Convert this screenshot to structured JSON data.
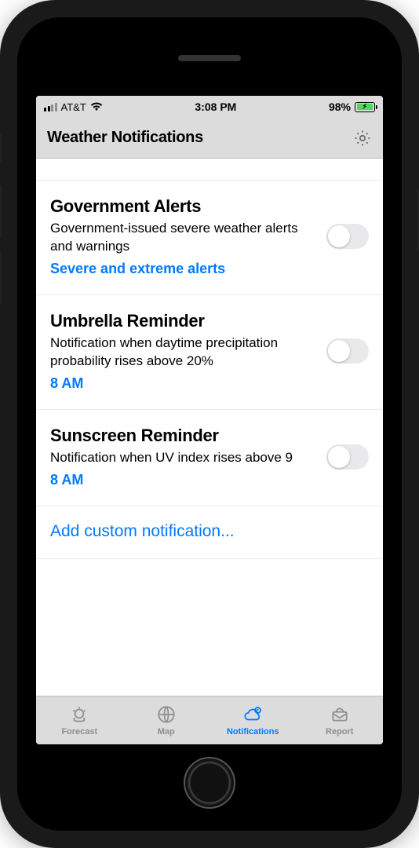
{
  "status": {
    "carrier": "AT&T",
    "time": "3:08 PM",
    "battery_pct": "98%"
  },
  "header": {
    "title": "Weather Notifications"
  },
  "sections": [
    {
      "title": "Government Alerts",
      "desc": "Government-issued severe weather alerts and warnings",
      "link": "Severe and extreme alerts"
    },
    {
      "title": "Umbrella Reminder",
      "desc": "Notification when daytime precipitation probability rises above 20%",
      "link": "8 AM"
    },
    {
      "title": "Sunscreen Reminder",
      "desc": "Notification when UV index rises above 9",
      "link": "8 AM"
    }
  ],
  "add_row": "Add custom notification...",
  "tabs": {
    "forecast": "Forecast",
    "map": "Map",
    "notifications": "Notifications",
    "report": "Report"
  }
}
